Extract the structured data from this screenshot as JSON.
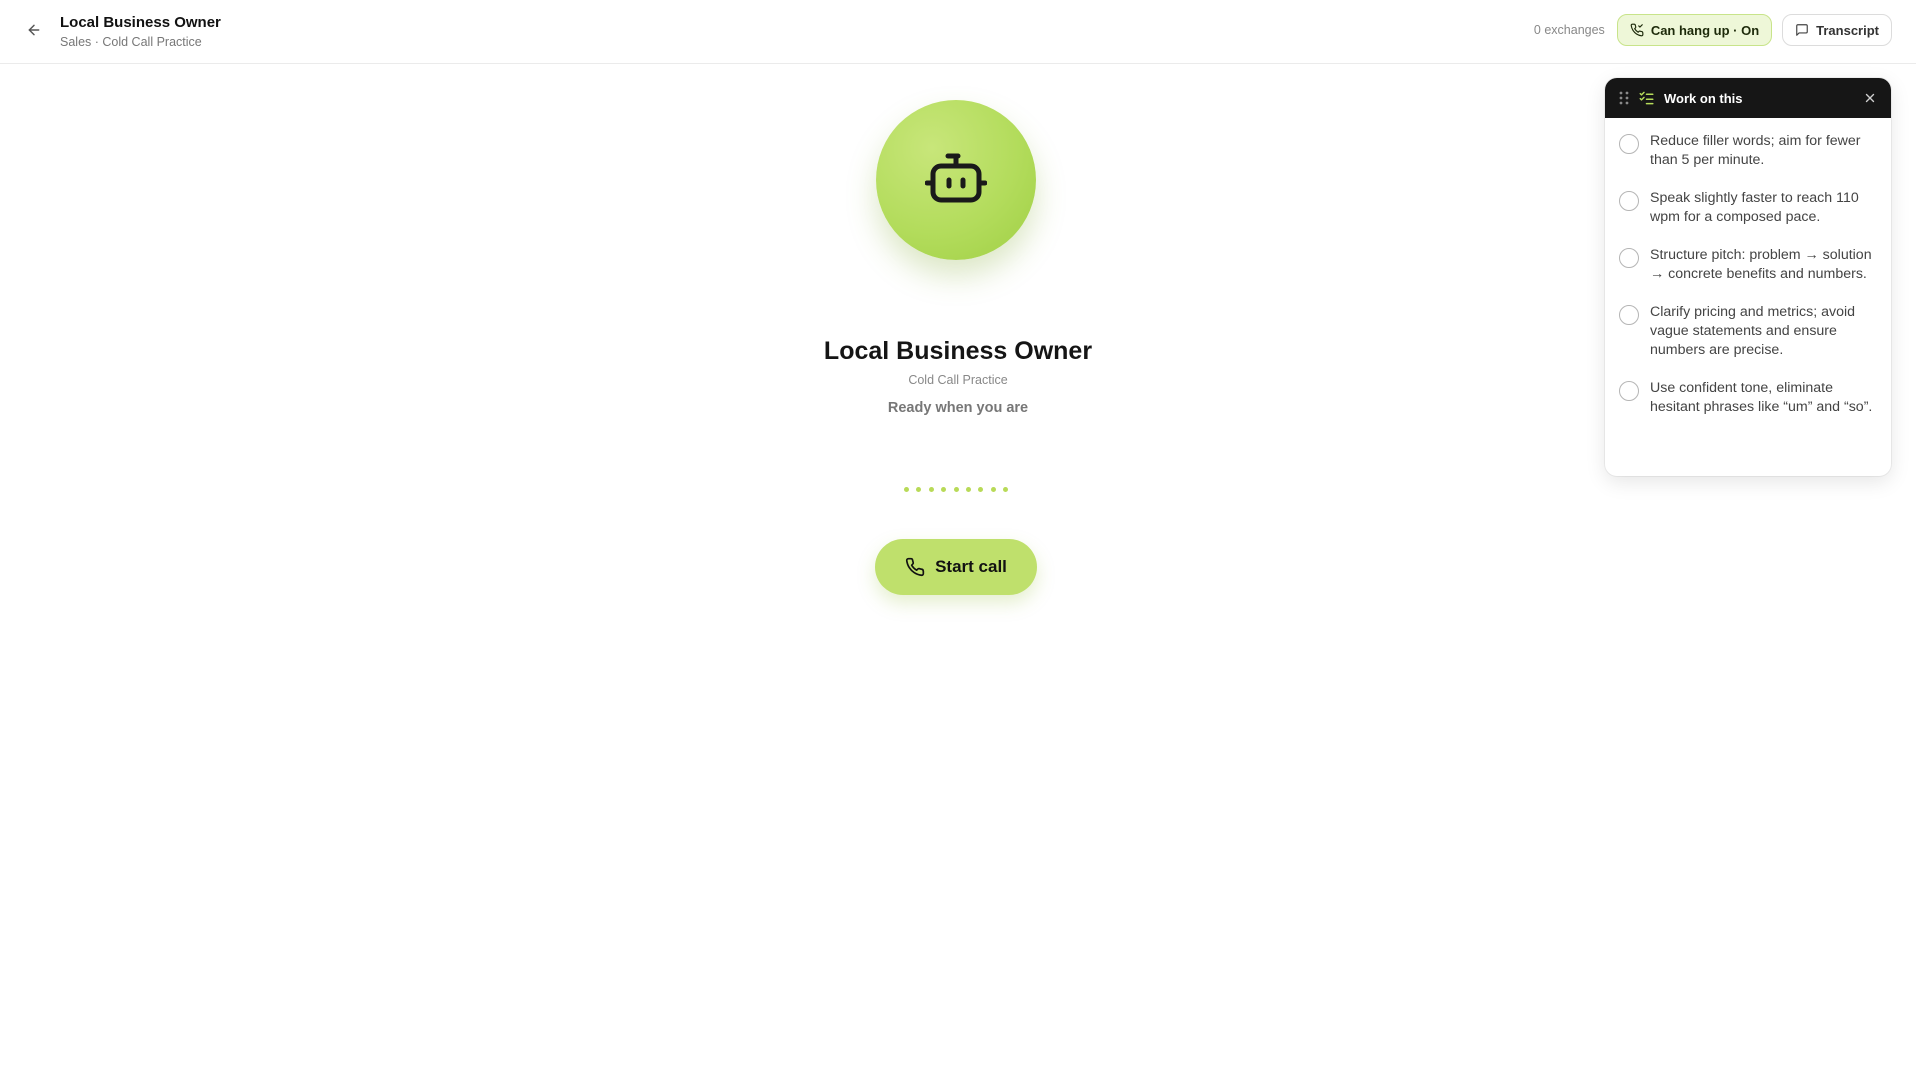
{
  "header": {
    "title": "Local Business Owner",
    "subtitle": "Sales · Cold Call Practice",
    "exchanges": "0 exchanges",
    "hangup_label": "Can hang up · On",
    "transcript_label": "Transcript"
  },
  "persona": {
    "name": "Local Business Owner",
    "scenario": "Cold Call Practice",
    "status": "Ready when you are",
    "avatar_icon": "bot-icon"
  },
  "call": {
    "start_label": "Start call"
  },
  "panel": {
    "title": "Work on this",
    "items": [
      "Reduce filler words; aim for fewer than 5 per minute.",
      "Speak slightly faster to reach 110 wpm for a composed pace.",
      "Structure pitch: problem → solution → concrete benefits and numbers.",
      "Clarify pricing and metrics; avoid vague statements and ensure numbers are precise.",
      "Use confident tone, eliminate hesitant phrases like “um” and “so”."
    ]
  },
  "colors": {
    "accent": "#bfe06c",
    "accent_dark": "#9fcf44",
    "panel_header": "#161616"
  }
}
